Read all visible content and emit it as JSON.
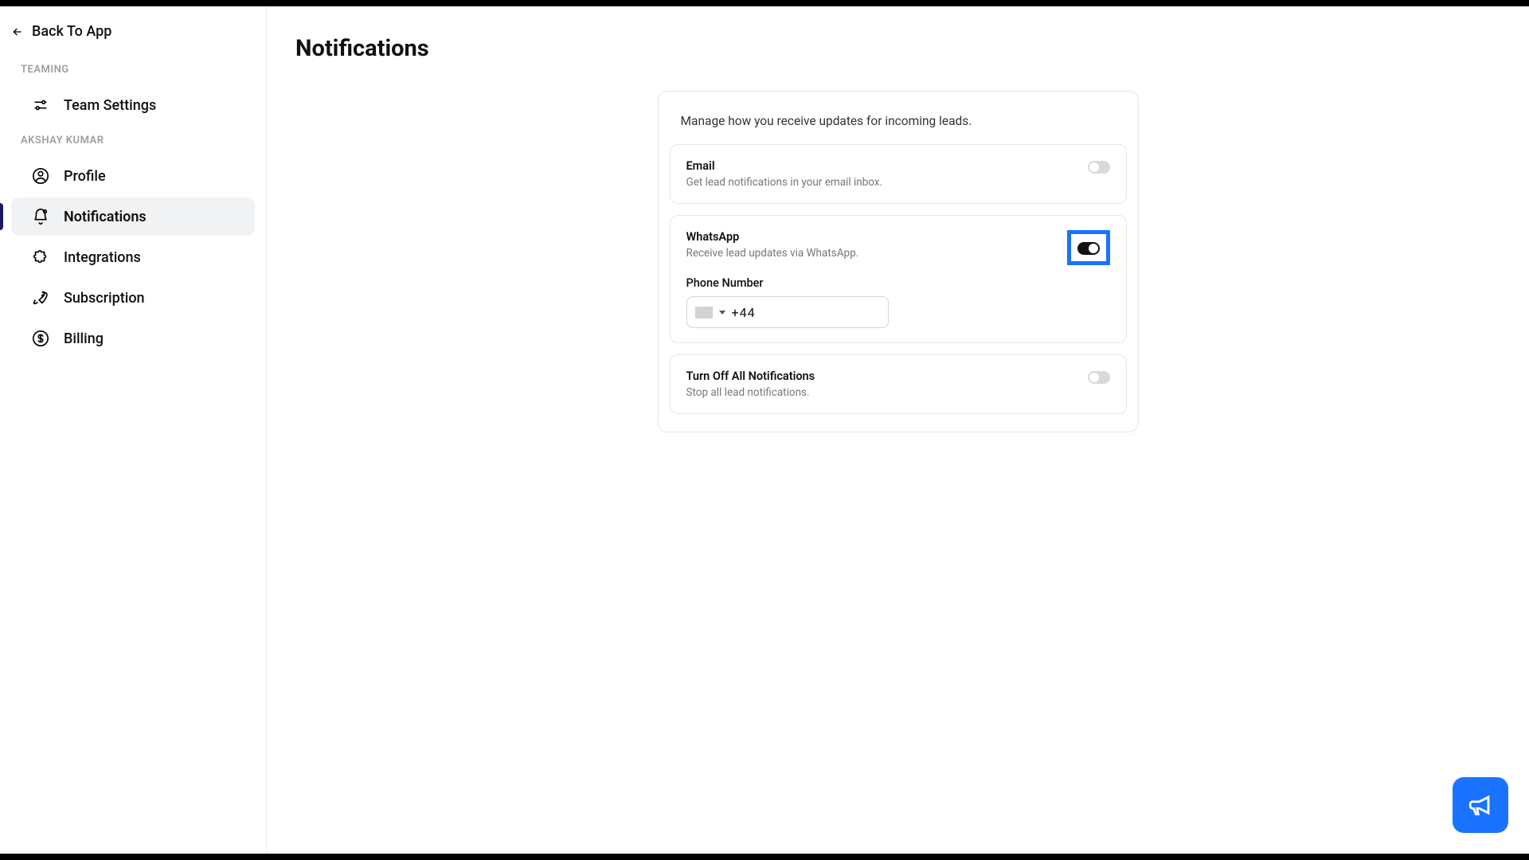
{
  "back": {
    "label": "Back To App"
  },
  "sidebar": {
    "section1_label": "TEAMING",
    "section2_label": "AKSHAY KUMAR",
    "team_settings": "Team Settings",
    "profile": "Profile",
    "notifications": "Notifications",
    "integrations": "Integrations",
    "subscription": "Subscription",
    "billing": "Billing"
  },
  "page": {
    "title": "Notifications"
  },
  "card": {
    "subtitle": "Manage how you receive updates for incoming leads.",
    "email": {
      "title": "Email",
      "desc": "Get lead notifications in your email inbox."
    },
    "whatsapp": {
      "title": "WhatsApp",
      "desc": "Receive lead updates via WhatsApp.",
      "phone_label": "Phone Number",
      "phone_value": "+44"
    },
    "turn_off": {
      "title": "Turn Off All Notifications",
      "desc": "Stop all lead notifications."
    }
  }
}
